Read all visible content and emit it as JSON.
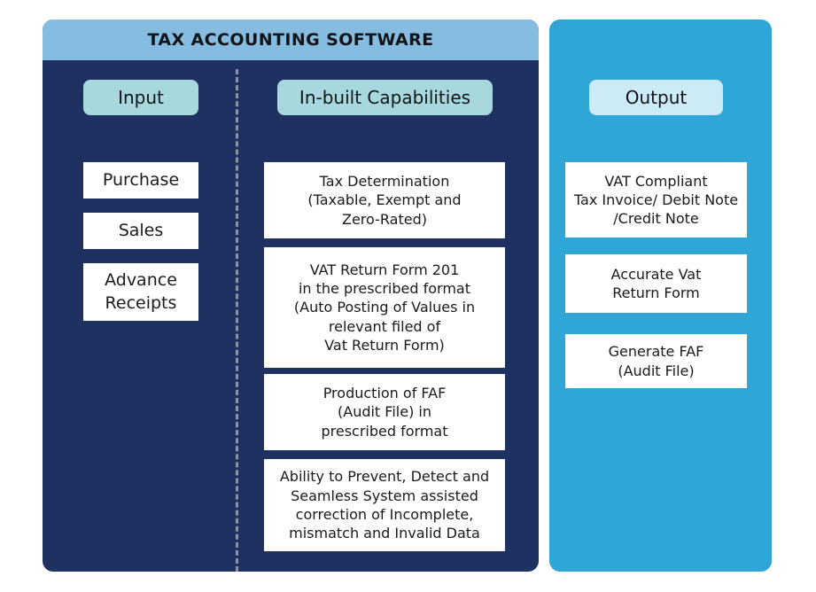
{
  "software_card": {
    "title": "TAX ACCOUNTING SOFTWARE",
    "header_color": "#86bcdf",
    "body_color": "#1e3160",
    "input_column": {
      "pill_label": "Input",
      "pill_color": "#a6d8de",
      "items": [
        "Purchase",
        "Sales",
        "Advance\nReceipts"
      ]
    },
    "capabilities_column": {
      "pill_label": "In-built Capabilities",
      "pill_color": "#a6d8de",
      "items": [
        "Tax Determination\n(Taxable, Exempt and\nZero-Rated)",
        "VAT Return Form 201\nin the prescribed format\n(Auto Posting of Values in\nrelevant filed of\nVat Return Form)",
        "Production of FAF\n(Audit File) in\nprescribed format",
        "Ability to Prevent, Detect and\nSeamless System assisted\ncorrection of Incomplete,\nmismatch   and Invalid Data"
      ]
    }
  },
  "output_card": {
    "pill_label": "Output",
    "pill_color": "#cdeaf7",
    "panel_color": "#2fa6d5",
    "items": [
      "VAT Compliant\nTax Invoice/ Debit Note\n/Credit Note",
      "Accurate Vat\nReturn Form",
      "Generate FAF\n(Audit File)"
    ]
  }
}
